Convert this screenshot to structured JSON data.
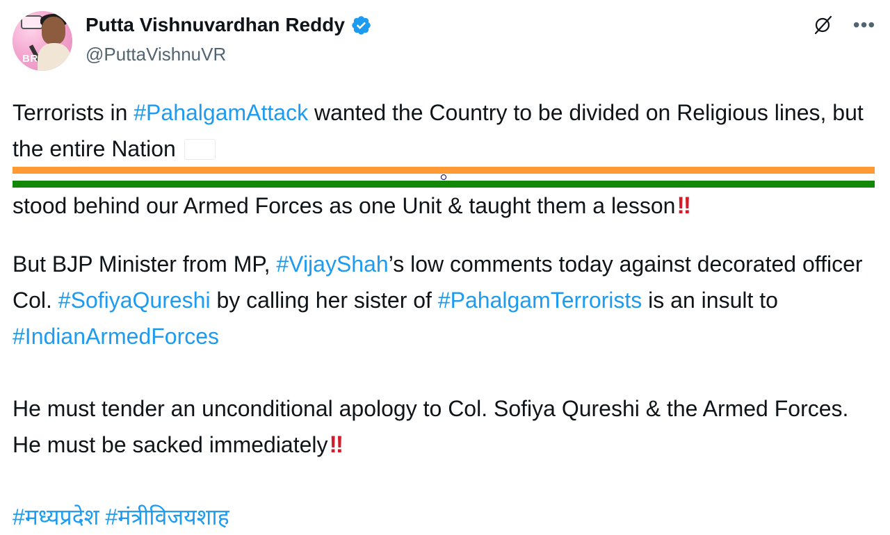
{
  "author": {
    "display_name": "Putta Vishnuvardhan Reddy",
    "handle": "@PuttaVishnuVR",
    "avatar_text": "BR",
    "verified_icon": "verified-badge-icon"
  },
  "actions": {
    "grok_icon": "grok-icon",
    "more_icon": "more-options-icon",
    "more_label": "•••"
  },
  "post": {
    "p1": {
      "t1": "Terrorists in ",
      "h1": "#PahalgamAttack",
      "t2": " wanted the Country to be divided on Religious lines, but the entire Nation ",
      "flag_icon": "india-flag-icon",
      "t3": " stood behind our Armed Forces as one Unit & taught them a lesson",
      "emoji": "‼"
    },
    "p2": {
      "t1": "But BJP Minister from MP, ",
      "h1": "#VijayShah",
      "t2": "’s low comments today against decorated officer Col. ",
      "h2": "#SofiyaQureshi",
      "t3": " by calling her sister of ",
      "h3": "#PahalgamTerrorists",
      "t4": " is an insult to ",
      "h4": "#IndianArmedForces"
    },
    "p3": {
      "t1": "He must tender an unconditional apology to Col. Sofiya Qureshi & the Armed Forces. He must be sacked immediately",
      "emoji": "‼"
    },
    "p4": {
      "h1": "#मध्यप्रदेश",
      "sep": " ",
      "h2": "#मंत्रीविजयशाह"
    }
  },
  "colors": {
    "text": "#0f1419",
    "secondary": "#536471",
    "hashtag": "#1d9bf0",
    "alert": "#d11c2b"
  }
}
